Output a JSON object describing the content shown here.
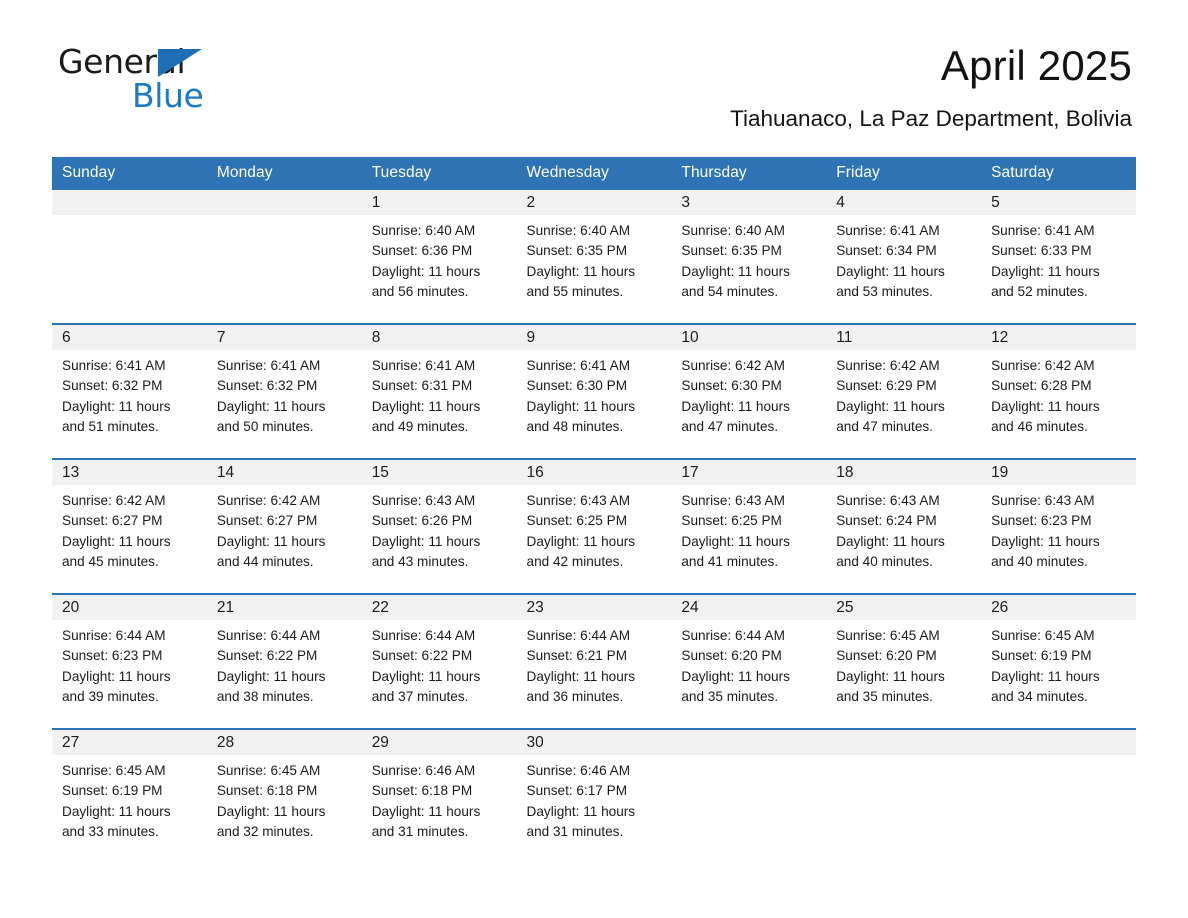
{
  "brand": {
    "name_part1": "General",
    "name_part2": "Blue",
    "triangle_color": "#1f6db5",
    "blue_color": "#1f7ac4"
  },
  "header": {
    "title": "April 2025",
    "subtitle": "Tiahuanaco, La Paz Department, Bolivia",
    "accent_color": "#2e74b5",
    "daynum_bg": "#f1f1f1"
  },
  "calendar": {
    "weekday_headers": [
      "Sunday",
      "Monday",
      "Tuesday",
      "Wednesday",
      "Thursday",
      "Friday",
      "Saturday"
    ],
    "weeks": [
      [
        {
          "day": "",
          "sunrise": "",
          "sunset": "",
          "daylight_line1": "",
          "daylight_line2": ""
        },
        {
          "day": "",
          "sunrise": "",
          "sunset": "",
          "daylight_line1": "",
          "daylight_line2": ""
        },
        {
          "day": "1",
          "sunrise": "Sunrise: 6:40 AM",
          "sunset": "Sunset: 6:36 PM",
          "daylight_line1": "Daylight: 11 hours",
          "daylight_line2": "and 56 minutes."
        },
        {
          "day": "2",
          "sunrise": "Sunrise: 6:40 AM",
          "sunset": "Sunset: 6:35 PM",
          "daylight_line1": "Daylight: 11 hours",
          "daylight_line2": "and 55 minutes."
        },
        {
          "day": "3",
          "sunrise": "Sunrise: 6:40 AM",
          "sunset": "Sunset: 6:35 PM",
          "daylight_line1": "Daylight: 11 hours",
          "daylight_line2": "and 54 minutes."
        },
        {
          "day": "4",
          "sunrise": "Sunrise: 6:41 AM",
          "sunset": "Sunset: 6:34 PM",
          "daylight_line1": "Daylight: 11 hours",
          "daylight_line2": "and 53 minutes."
        },
        {
          "day": "5",
          "sunrise": "Sunrise: 6:41 AM",
          "sunset": "Sunset: 6:33 PM",
          "daylight_line1": "Daylight: 11 hours",
          "daylight_line2": "and 52 minutes."
        }
      ],
      [
        {
          "day": "6",
          "sunrise": "Sunrise: 6:41 AM",
          "sunset": "Sunset: 6:32 PM",
          "daylight_line1": "Daylight: 11 hours",
          "daylight_line2": "and 51 minutes."
        },
        {
          "day": "7",
          "sunrise": "Sunrise: 6:41 AM",
          "sunset": "Sunset: 6:32 PM",
          "daylight_line1": "Daylight: 11 hours",
          "daylight_line2": "and 50 minutes."
        },
        {
          "day": "8",
          "sunrise": "Sunrise: 6:41 AM",
          "sunset": "Sunset: 6:31 PM",
          "daylight_line1": "Daylight: 11 hours",
          "daylight_line2": "and 49 minutes."
        },
        {
          "day": "9",
          "sunrise": "Sunrise: 6:41 AM",
          "sunset": "Sunset: 6:30 PM",
          "daylight_line1": "Daylight: 11 hours",
          "daylight_line2": "and 48 minutes."
        },
        {
          "day": "10",
          "sunrise": "Sunrise: 6:42 AM",
          "sunset": "Sunset: 6:30 PM",
          "daylight_line1": "Daylight: 11 hours",
          "daylight_line2": "and 47 minutes."
        },
        {
          "day": "11",
          "sunrise": "Sunrise: 6:42 AM",
          "sunset": "Sunset: 6:29 PM",
          "daylight_line1": "Daylight: 11 hours",
          "daylight_line2": "and 47 minutes."
        },
        {
          "day": "12",
          "sunrise": "Sunrise: 6:42 AM",
          "sunset": "Sunset: 6:28 PM",
          "daylight_line1": "Daylight: 11 hours",
          "daylight_line2": "and 46 minutes."
        }
      ],
      [
        {
          "day": "13",
          "sunrise": "Sunrise: 6:42 AM",
          "sunset": "Sunset: 6:27 PM",
          "daylight_line1": "Daylight: 11 hours",
          "daylight_line2": "and 45 minutes."
        },
        {
          "day": "14",
          "sunrise": "Sunrise: 6:42 AM",
          "sunset": "Sunset: 6:27 PM",
          "daylight_line1": "Daylight: 11 hours",
          "daylight_line2": "and 44 minutes."
        },
        {
          "day": "15",
          "sunrise": "Sunrise: 6:43 AM",
          "sunset": "Sunset: 6:26 PM",
          "daylight_line1": "Daylight: 11 hours",
          "daylight_line2": "and 43 minutes."
        },
        {
          "day": "16",
          "sunrise": "Sunrise: 6:43 AM",
          "sunset": "Sunset: 6:25 PM",
          "daylight_line1": "Daylight: 11 hours",
          "daylight_line2": "and 42 minutes."
        },
        {
          "day": "17",
          "sunrise": "Sunrise: 6:43 AM",
          "sunset": "Sunset: 6:25 PM",
          "daylight_line1": "Daylight: 11 hours",
          "daylight_line2": "and 41 minutes."
        },
        {
          "day": "18",
          "sunrise": "Sunrise: 6:43 AM",
          "sunset": "Sunset: 6:24 PM",
          "daylight_line1": "Daylight: 11 hours",
          "daylight_line2": "and 40 minutes."
        },
        {
          "day": "19",
          "sunrise": "Sunrise: 6:43 AM",
          "sunset": "Sunset: 6:23 PM",
          "daylight_line1": "Daylight: 11 hours",
          "daylight_line2": "and 40 minutes."
        }
      ],
      [
        {
          "day": "20",
          "sunrise": "Sunrise: 6:44 AM",
          "sunset": "Sunset: 6:23 PM",
          "daylight_line1": "Daylight: 11 hours",
          "daylight_line2": "and 39 minutes."
        },
        {
          "day": "21",
          "sunrise": "Sunrise: 6:44 AM",
          "sunset": "Sunset: 6:22 PM",
          "daylight_line1": "Daylight: 11 hours",
          "daylight_line2": "and 38 minutes."
        },
        {
          "day": "22",
          "sunrise": "Sunrise: 6:44 AM",
          "sunset": "Sunset: 6:22 PM",
          "daylight_line1": "Daylight: 11 hours",
          "daylight_line2": "and 37 minutes."
        },
        {
          "day": "23",
          "sunrise": "Sunrise: 6:44 AM",
          "sunset": "Sunset: 6:21 PM",
          "daylight_line1": "Daylight: 11 hours",
          "daylight_line2": "and 36 minutes."
        },
        {
          "day": "24",
          "sunrise": "Sunrise: 6:44 AM",
          "sunset": "Sunset: 6:20 PM",
          "daylight_line1": "Daylight: 11 hours",
          "daylight_line2": "and 35 minutes."
        },
        {
          "day": "25",
          "sunrise": "Sunrise: 6:45 AM",
          "sunset": "Sunset: 6:20 PM",
          "daylight_line1": "Daylight: 11 hours",
          "daylight_line2": "and 35 minutes."
        },
        {
          "day": "26",
          "sunrise": "Sunrise: 6:45 AM",
          "sunset": "Sunset: 6:19 PM",
          "daylight_line1": "Daylight: 11 hours",
          "daylight_line2": "and 34 minutes."
        }
      ],
      [
        {
          "day": "27",
          "sunrise": "Sunrise: 6:45 AM",
          "sunset": "Sunset: 6:19 PM",
          "daylight_line1": "Daylight: 11 hours",
          "daylight_line2": "and 33 minutes."
        },
        {
          "day": "28",
          "sunrise": "Sunrise: 6:45 AM",
          "sunset": "Sunset: 6:18 PM",
          "daylight_line1": "Daylight: 11 hours",
          "daylight_line2": "and 32 minutes."
        },
        {
          "day": "29",
          "sunrise": "Sunrise: 6:46 AM",
          "sunset": "Sunset: 6:18 PM",
          "daylight_line1": "Daylight: 11 hours",
          "daylight_line2": "and 31 minutes."
        },
        {
          "day": "30",
          "sunrise": "Sunrise: 6:46 AM",
          "sunset": "Sunset: 6:17 PM",
          "daylight_line1": "Daylight: 11 hours",
          "daylight_line2": "and 31 minutes."
        },
        {
          "day": "",
          "sunrise": "",
          "sunset": "",
          "daylight_line1": "",
          "daylight_line2": ""
        },
        {
          "day": "",
          "sunrise": "",
          "sunset": "",
          "daylight_line1": "",
          "daylight_line2": ""
        },
        {
          "day": "",
          "sunrise": "",
          "sunset": "",
          "daylight_line1": "",
          "daylight_line2": ""
        }
      ]
    ]
  }
}
